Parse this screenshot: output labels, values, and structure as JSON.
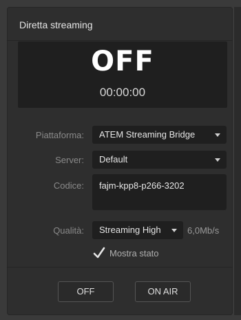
{
  "header": {
    "title": "Diretta streaming"
  },
  "status": {
    "state": "OFF",
    "timer": "00:00:00"
  },
  "form": {
    "platform": {
      "label": "Piattaforma:",
      "value": "ATEM Streaming Bridge"
    },
    "server": {
      "label": "Server:",
      "value": "Default"
    },
    "key": {
      "label": "Codice:",
      "value": "fajm-kpp8-p266-3202"
    },
    "quality": {
      "label": "Qualità:",
      "value": "Streaming High",
      "bitrate": "6,0Mb/s"
    },
    "show_status": {
      "label": "Mostra stato",
      "checked": true
    }
  },
  "buttons": {
    "off_label": "OFF",
    "on_air_label": "ON AIR"
  },
  "icons": {
    "dropdown": "chevron-down-icon",
    "check": "checkmark-icon"
  }
}
